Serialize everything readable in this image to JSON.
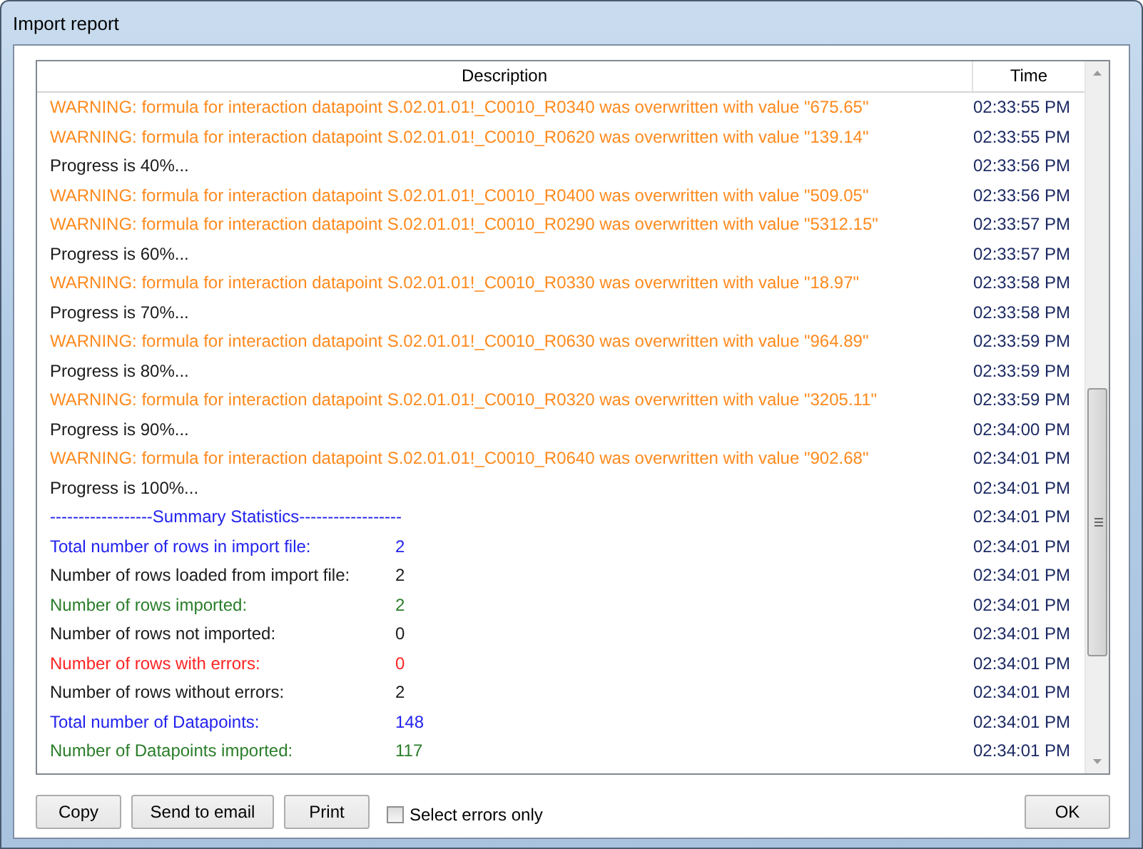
{
  "window": {
    "title": "Import report"
  },
  "table": {
    "columns": [
      "Description",
      "Time"
    ],
    "rows": [
      {
        "kind": "warning",
        "description": "WARNING: formula for interaction datapoint S.02.01.01!_C0010_R0340 was overwritten with value \"675.65\"",
        "time": "02:33:55 PM"
      },
      {
        "kind": "warning",
        "description": "WARNING: formula for interaction datapoint S.02.01.01!_C0010_R0620 was overwritten with value \"139.14\"",
        "time": "02:33:55 PM"
      },
      {
        "kind": "info",
        "description": "Progress is 40%...",
        "time": "02:33:56 PM"
      },
      {
        "kind": "warning",
        "description": "WARNING: formula for interaction datapoint S.02.01.01!_C0010_R0400 was overwritten with value \"509.05\"",
        "time": "02:33:56 PM"
      },
      {
        "kind": "warning",
        "description": "WARNING: formula for interaction datapoint S.02.01.01!_C0010_R0290 was overwritten with value \"5312.15\"",
        "time": "02:33:57 PM"
      },
      {
        "kind": "info",
        "description": "Progress is 60%...",
        "time": "02:33:57 PM"
      },
      {
        "kind": "warning",
        "description": "WARNING: formula for interaction datapoint S.02.01.01!_C0010_R0330 was overwritten with value \"18.97\"",
        "time": "02:33:58 PM"
      },
      {
        "kind": "info",
        "description": "Progress is 70%...",
        "time": "02:33:58 PM"
      },
      {
        "kind": "warning",
        "description": "WARNING: formula for interaction datapoint S.02.01.01!_C0010_R0630 was overwritten with value \"964.89\"",
        "time": "02:33:59 PM"
      },
      {
        "kind": "info",
        "description": "Progress is 80%...",
        "time": "02:33:59 PM"
      },
      {
        "kind": "warning",
        "description": "WARNING: formula for interaction datapoint S.02.01.01!_C0010_R0320 was overwritten with value \"3205.11\"",
        "time": "02:33:59 PM"
      },
      {
        "kind": "info",
        "description": "Progress is 90%...",
        "time": "02:34:00 PM"
      },
      {
        "kind": "warning",
        "description": "WARNING: formula for interaction datapoint S.02.01.01!_C0010_R0640 was overwritten with value \"902.68\"",
        "time": "02:34:01 PM"
      },
      {
        "kind": "info",
        "description": "Progress is 100%...",
        "time": "02:34:01 PM"
      },
      {
        "kind": "total",
        "description": "------------------Summary Statistics------------------",
        "time": "02:34:01 PM"
      },
      {
        "kind": "total",
        "description": "Total number of rows in import file:",
        "value": "2",
        "time": "02:34:01 PM"
      },
      {
        "kind": "info",
        "description": "Number of rows loaded from import file:",
        "value": "2",
        "time": "02:34:01 PM"
      },
      {
        "kind": "success",
        "description": "Number of rows imported:",
        "value": "2",
        "time": "02:34:01 PM"
      },
      {
        "kind": "info",
        "description": "Number of rows not imported:",
        "value": "0",
        "time": "02:34:01 PM"
      },
      {
        "kind": "error",
        "description": "Number of rows with errors:",
        "value": "0",
        "time": "02:34:01 PM"
      },
      {
        "kind": "info",
        "description": "Number of rows without errors:",
        "value": "2",
        "time": "02:34:01 PM"
      },
      {
        "kind": "total",
        "description": "Total number of Datapoints:",
        "value": "148",
        "time": "02:34:01 PM"
      },
      {
        "kind": "success",
        "description": "Number of Datapoints imported:",
        "value": "117",
        "time": "02:34:01 PM"
      }
    ]
  },
  "buttons": [
    "Copy",
    "Send to email",
    "Print"
  ],
  "errors_only": {
    "label": "Select errors only",
    "checked": false
  },
  "ok_button": "OK"
}
